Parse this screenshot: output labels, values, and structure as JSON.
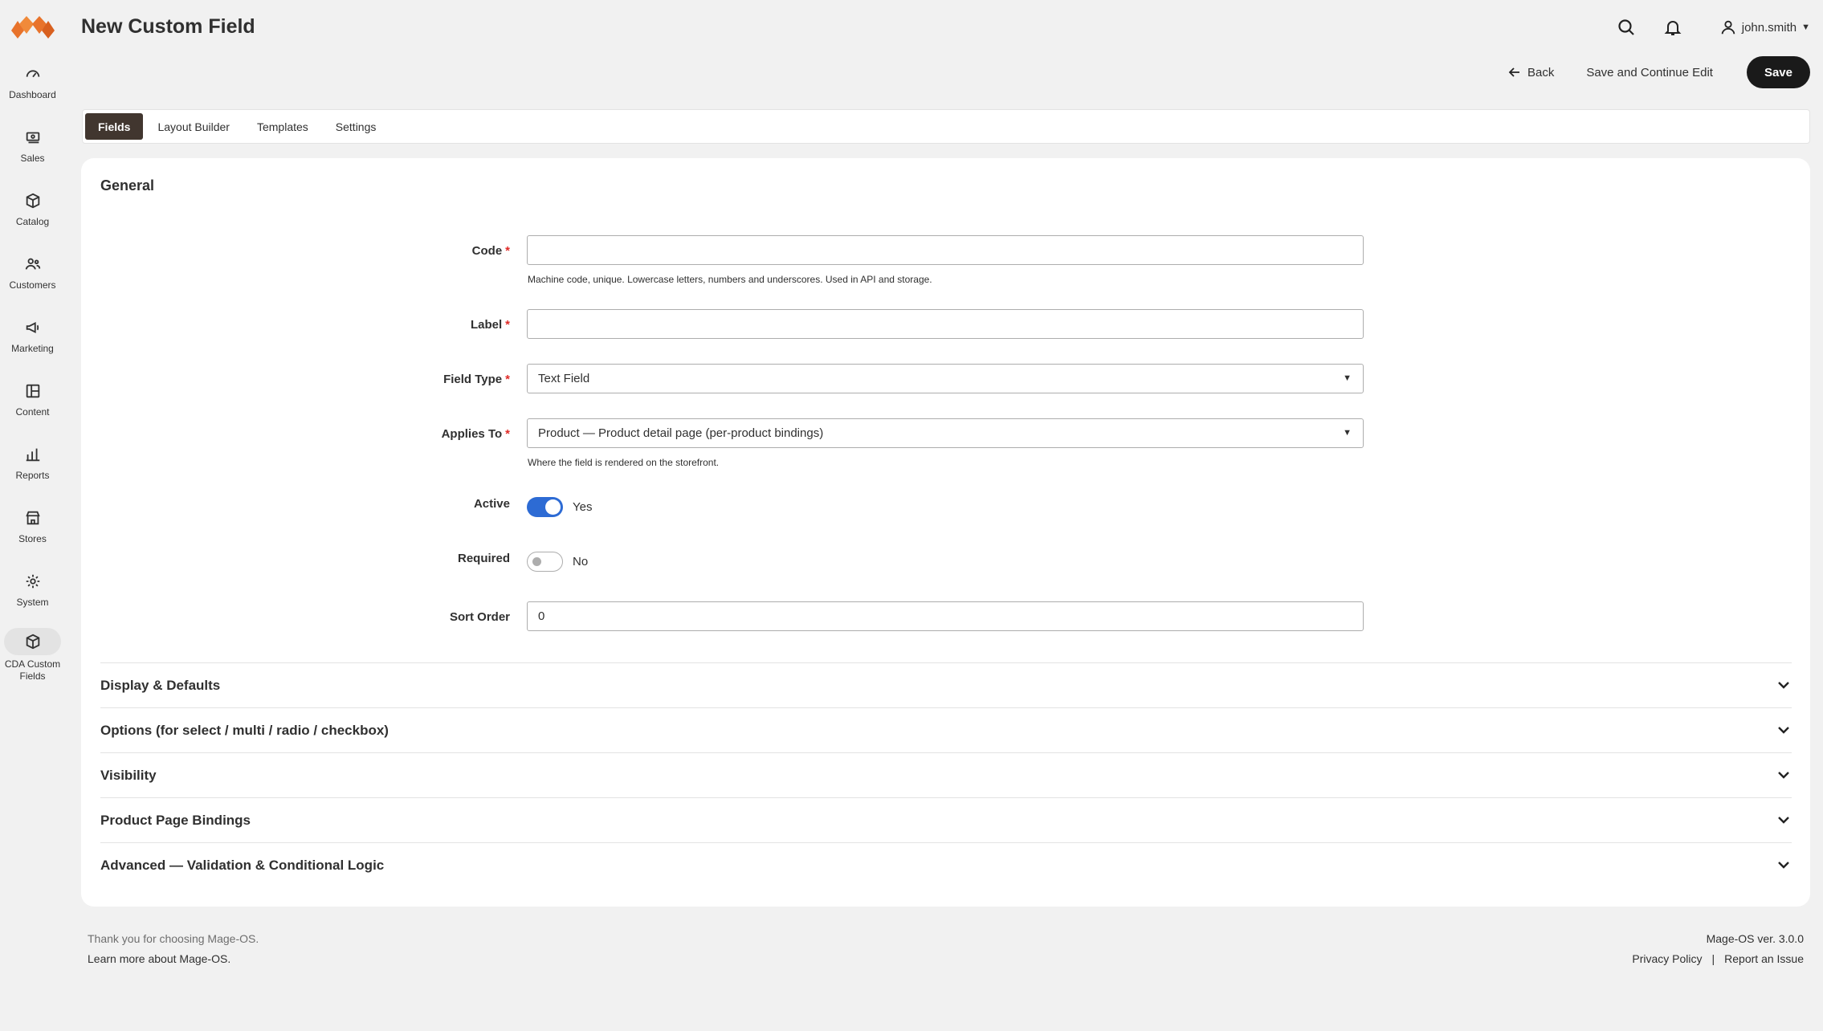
{
  "header": {
    "title": "New Custom Field",
    "username": "john.smith"
  },
  "sidebar": {
    "items": [
      {
        "label": "Dashboard",
        "icon": "gauge-icon"
      },
      {
        "label": "Sales",
        "icon": "money-icon"
      },
      {
        "label": "Catalog",
        "icon": "box-icon"
      },
      {
        "label": "Customers",
        "icon": "users-icon"
      },
      {
        "label": "Marketing",
        "icon": "megaphone-icon"
      },
      {
        "label": "Content",
        "icon": "layout-icon"
      },
      {
        "label": "Reports",
        "icon": "bar-chart-icon"
      },
      {
        "label": "Stores",
        "icon": "store-icon"
      },
      {
        "label": "System",
        "icon": "gear-icon"
      },
      {
        "label": "CDA Custom Fields",
        "icon": "box-icon",
        "active": true
      }
    ]
  },
  "actions": {
    "back": "Back",
    "save_continue": "Save and Continue Edit",
    "save": "Save"
  },
  "tabs": [
    {
      "label": "Fields",
      "active": true
    },
    {
      "label": "Layout Builder"
    },
    {
      "label": "Templates"
    },
    {
      "label": "Settings"
    }
  ],
  "general": {
    "title": "General",
    "code": {
      "label": "Code",
      "value": "",
      "hint": "Machine code, unique. Lowercase letters, numbers and underscores. Used in API and storage."
    },
    "label": {
      "label": "Label",
      "value": ""
    },
    "field_type": {
      "label": "Field Type",
      "value": "Text Field"
    },
    "applies_to": {
      "label": "Applies To",
      "value": "Product — Product detail page (per-product bindings)",
      "hint": "Where the field is rendered on the storefront."
    },
    "active": {
      "label": "Active",
      "state": "Yes"
    },
    "required": {
      "label": "Required",
      "state": "No"
    },
    "sort_order": {
      "label": "Sort Order",
      "value": "0"
    }
  },
  "sections": [
    "Display & Defaults",
    "Options (for select / multi / radio / checkbox)",
    "Visibility",
    "Product Page Bindings",
    "Advanced — Validation & Conditional Logic"
  ],
  "footer": {
    "thanks": "Thank you for choosing Mage-OS.",
    "learn_more": "Learn more about Mage-OS.",
    "version": "Mage-OS ver. 3.0.0",
    "privacy": "Privacy Policy",
    "report": "Report an Issue",
    "separator": "|"
  },
  "colors": {
    "accent": "#2d6bd4",
    "brand": "#f26322",
    "active_tab": "#41362f",
    "required": "#e02b27"
  }
}
